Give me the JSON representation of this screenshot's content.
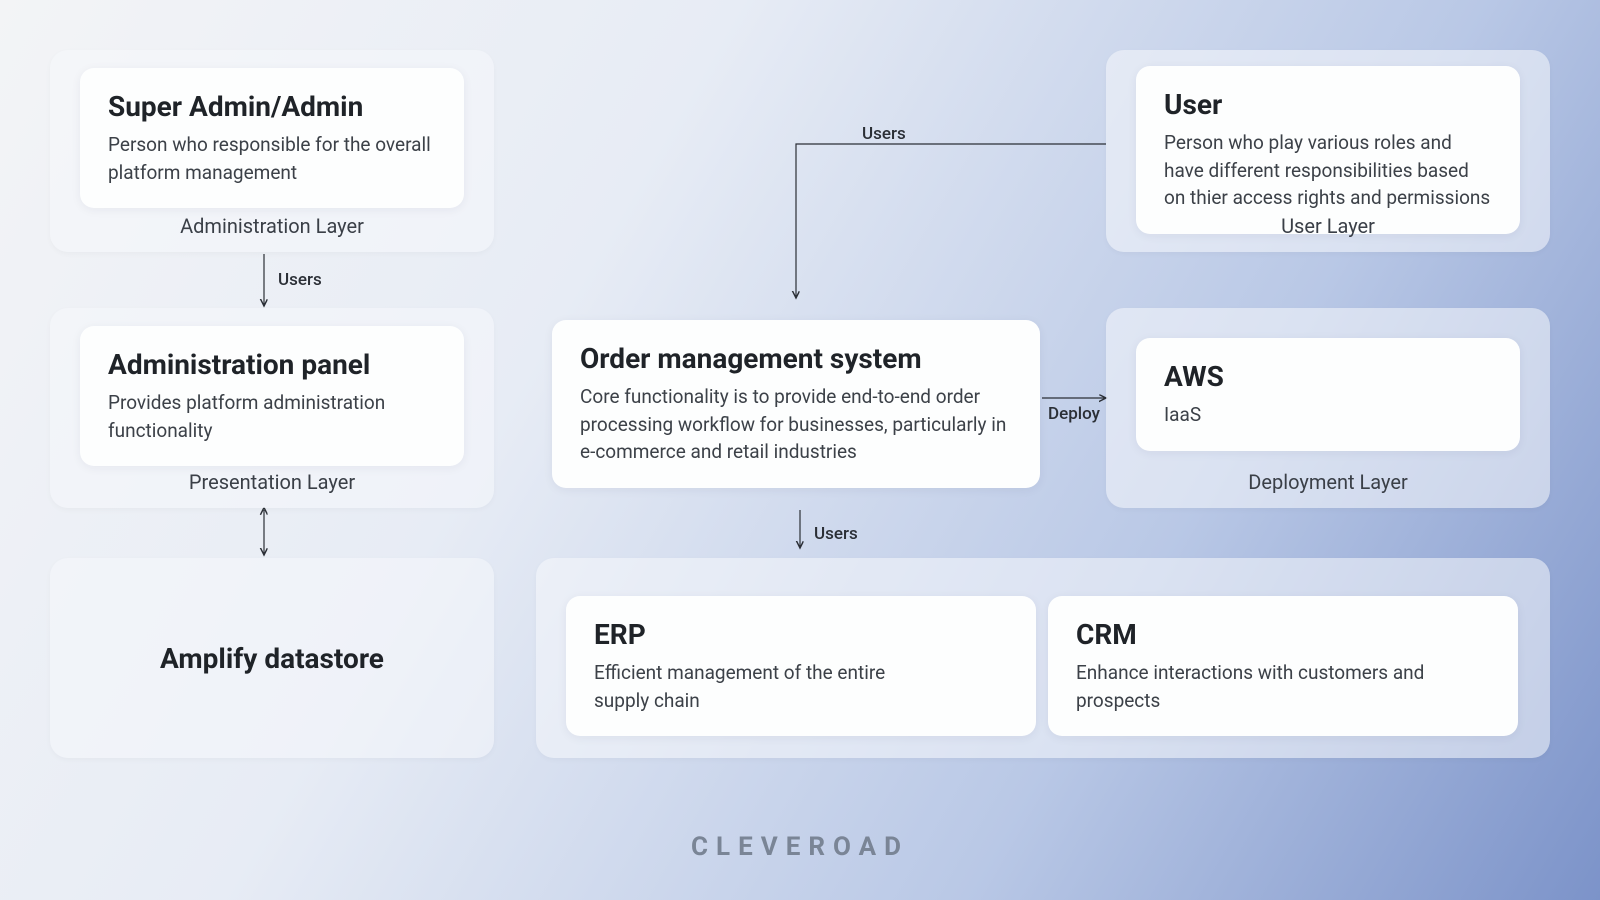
{
  "brand": "CLEVEROAD",
  "layers": {
    "administration": {
      "label": "Administration Layer"
    },
    "presentation": {
      "label": "Presentation Layer"
    },
    "user": {
      "label": "User Layer"
    },
    "deployment": {
      "label": "Deployment Layer"
    }
  },
  "cards": {
    "super_admin": {
      "title": "Super Admin/Admin",
      "desc": "Person who responsible for the overall platform management"
    },
    "admin_panel": {
      "title": "Administration panel",
      "desc": "Provides platform administration functionality"
    },
    "datastore": {
      "title": "Amplify datastore"
    },
    "oms": {
      "title": "Order management system",
      "desc": "Core functionality is to provide end-to-end order processing workflow for businesses, particularly in e-commerce and retail industries"
    },
    "user": {
      "title": "User",
      "desc": "Person who play various roles and have different responsibilities based on thier access rights and permissions"
    },
    "aws": {
      "title": "AWS",
      "desc": "IaaS"
    },
    "erp": {
      "title": "ERP",
      "desc": "Efficient management of the entire supply chain"
    },
    "crm": {
      "title": "CRM",
      "desc": "Enhance interactions with customers and prospects"
    }
  },
  "edges": {
    "admin_to_panel": "Users",
    "user_to_oms": "Users",
    "oms_to_integrations": "Users",
    "oms_to_aws": "Deploy"
  }
}
